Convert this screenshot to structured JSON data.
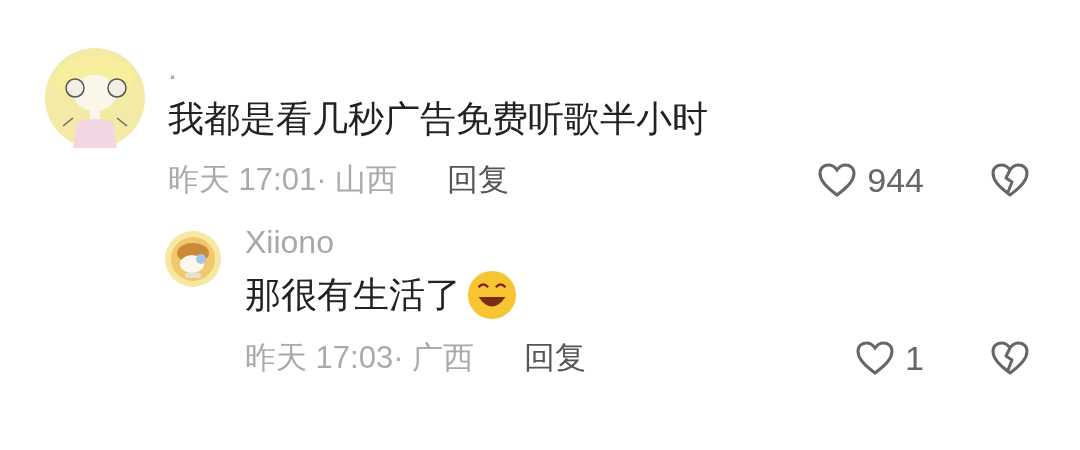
{
  "comments": [
    {
      "author": ".",
      "text": "我都是看几秒广告免费听歌半小时",
      "emoji_after": false,
      "meta": "昨天 17:01· 山西",
      "reply_label": "回复",
      "likes": "944",
      "replies": [
        {
          "author": "Xiiono",
          "text": "那很有生活了",
          "emoji_after": true,
          "meta": "昨天 17:03· 广西",
          "reply_label": "回复",
          "likes": "1"
        }
      ]
    }
  ]
}
